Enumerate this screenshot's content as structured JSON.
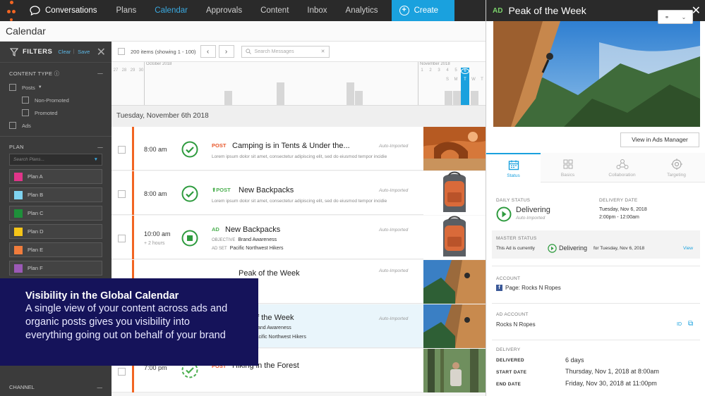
{
  "nav": {
    "conversations": "Conversations",
    "items": [
      "Plans",
      "Calendar",
      "Approvals",
      "Content",
      "Inbox",
      "Analytics"
    ],
    "active": "Calendar",
    "create": "Create"
  },
  "page_title": "Calendar",
  "filters": {
    "title": "FILTERS",
    "clear": "Clear",
    "save": "Save",
    "content_type": "CONTENT TYPE",
    "posts": "Posts",
    "non_promoted": "Non-Promoted",
    "promoted": "Promoted",
    "ads": "Ads",
    "plan_heading": "PLAN",
    "plan_search_placeholder": "Search Plans...",
    "plans": [
      {
        "label": "Plan A",
        "color": "#e0358a"
      },
      {
        "label": "Plan B",
        "color": "#7fd3f0"
      },
      {
        "label": "Plan C",
        "color": "#1e8f3a"
      },
      {
        "label": "Plan D",
        "color": "#f5c518"
      },
      {
        "label": "Plan E",
        "color": "#f07c3c"
      },
      {
        "label": "Plan F",
        "color": "#9b59b6"
      }
    ],
    "channel": "CHANNEL"
  },
  "toolbar": {
    "items_count": "200 items (showing 1 - 100)",
    "search_placeholder": "Search Messages"
  },
  "timeline": {
    "month1": "October 2018",
    "month2": "November 2018",
    "days_before": [
      "27",
      "28",
      "29",
      "30"
    ],
    "days_after": [
      "1",
      "2",
      "3",
      "4",
      "5"
    ],
    "selected_day": "6",
    "weekday_letters": [
      "S",
      "M",
      "T",
      "W",
      "T"
    ]
  },
  "date_header": "Tuesday, November 6th 2018",
  "rows": [
    {
      "time": "8:00 am",
      "type": "POST",
      "title": "Camping is in Tents & Under the...",
      "desc": "Lorem ipsum dolor sit amet, consectetur adipiscing elit, sed do eiusmod tempor incidie",
      "auto": "Auto-Imported"
    },
    {
      "time": "8:00 am",
      "type": "POST",
      "title": "New Backpacks",
      "desc": "Lorem ipsum dolor sit amet, consectetur adipiscing elit, sed do eiusmod tempor incidie",
      "auto": "Auto-Imported"
    },
    {
      "time": "10:00 am",
      "duration": "+ 2 hours",
      "type": "AD",
      "title": "New Backpacks",
      "objective_label": "OBJECTIVE",
      "objective": "Brand Awareness",
      "adset_label": "AD SET",
      "adset": "Pacific Northwest Hikers",
      "auto": "Auto-Imported"
    },
    {
      "title": "Peak of the Week",
      "auto": "Auto-Imported"
    },
    {
      "title": "of the Week",
      "objective": "Brand Awareness",
      "adset": "Pacific Northwest Hikers",
      "auto": "Auto-Imported"
    },
    {
      "time": "7:00 pm",
      "type": "POST",
      "title": "Hiking in the Forest"
    }
  ],
  "overlay": {
    "heading": "Visibility in the Global Calendar",
    "body": "A single view of your content across ads and organic posts gives you visibility into everything going out on behalf of your brand"
  },
  "panel": {
    "badge": "AD",
    "title": "Peak of the Week",
    "ads_manager": "View in Ads Manager",
    "tabs": [
      "Status",
      "Basics",
      "Collaboration",
      "Targeting"
    ],
    "daily_status_label": "DAILY STATUS",
    "daily_status": "Delivering",
    "daily_status_sub": "Auto-Imported",
    "delivery_date_label": "DELIVERY DATE",
    "delivery_date_line1": "Tuesday, Nov 6, 2018",
    "delivery_date_line2": "2:00pm - 12:00am",
    "master_status_label": "MASTER STATUS",
    "master_prefix": "This Ad is currently",
    "master_status": "Delivering",
    "master_suffix": "for Tuesday, Nov 6, 2018",
    "master_view": "View",
    "account_label": "ACCOUNT",
    "account": "Page: Rocks N Ropes",
    "ad_account_label": "AD ACCOUNT",
    "ad_account": "Rocks N Ropes",
    "id_label": "ID",
    "delivery_label": "DELIVERY",
    "delivered_label": "DELIVERED",
    "delivered": "6 days",
    "start_label": "START DATE",
    "start": "Thursday, Nov 1, 2018 at 8:00am",
    "end_label": "END DATE",
    "end": "Friday, Nov 30, 2018 at 11:00pm"
  }
}
